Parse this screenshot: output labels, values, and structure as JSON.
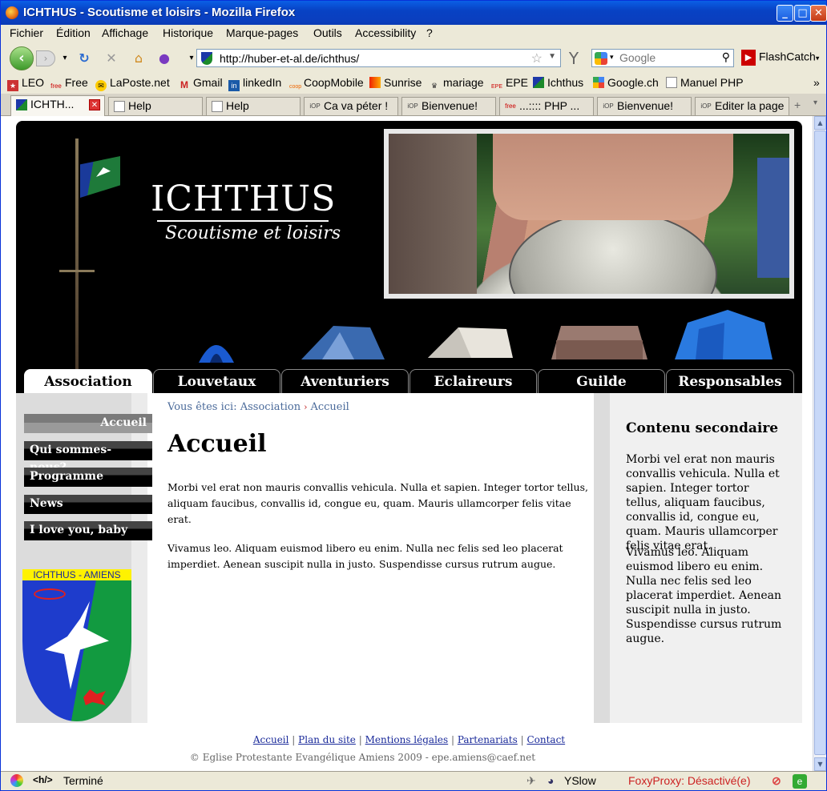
{
  "window": {
    "title": "ICHTHUS - Scoutisme et loisirs - Mozilla Firefox"
  },
  "menu": [
    "Fichier",
    "Édition",
    "Affichage",
    "Historique",
    "Marque-pages",
    "Outils",
    "Accessibility",
    "?"
  ],
  "toolbar": {
    "url": "http://huber-et-al.de/ichthus/",
    "search_placeholder": "Google",
    "flashcatch": "FlashCatch"
  },
  "bookmarks": [
    "LEO",
    "Free",
    "LaPoste.net",
    "Gmail",
    "linkedIn",
    "CoopMobile",
    "Sunrise",
    "mariage",
    "EPE",
    "Ichthus",
    "Google.ch",
    "Manuel PHP"
  ],
  "tabs": [
    "ICHTH...",
    "Help",
    "Help",
    "Ca va péter !",
    "Bienvenue!",
    "...:::: PHP ...",
    "Bienvenue!",
    "Editer la page"
  ],
  "site": {
    "logo_title": "ICHTHUS",
    "logo_subtitle": "Scoutisme et loisirs",
    "nav": [
      "Association",
      "Louvetaux",
      "Aventuriers",
      "Eclaireurs",
      "Guilde",
      "Responsables"
    ],
    "sidebar": [
      "Accueil",
      "Qui sommes-nous?",
      "Programme",
      "News",
      "I love you, baby"
    ],
    "crest_label": "ICHTHUS - AMIENS",
    "breadcrumb": {
      "prefix": "Vous êtes ici:",
      "section": "Association",
      "page": "Accueil"
    },
    "heading": "Accueil",
    "paragraphs": [
      "Morbi vel erat non mauris convallis vehicula. Nulla et sapien. Integer tortor tellus, aliquam faucibus, convallis id, congue eu, quam. Mauris ullamcorper felis vitae erat.",
      "Vivamus leo. Aliquam euismod libero eu enim. Nulla nec felis sed leo placerat imperdiet. Aenean suscipit nulla in justo. Suspendisse cursus rutrum augue."
    ],
    "secondary": {
      "title": "Contenu secondaire",
      "paragraphs": [
        "Morbi vel erat non mauris convallis vehicula. Nulla et sapien. Integer tortor tellus, aliquam faucibus, convallis id, congue eu, quam. Mauris ullamcorper felis vitae erat.",
        "Vivamus leo. Aliquam euismod libero eu enim. Nulla nec felis sed leo placerat imperdiet. Aenean suscipit nulla in justo. Suspendisse cursus rutrum augue."
      ]
    },
    "footer_links": [
      "Accueil",
      "Plan du site",
      "Mentions légales",
      "Partenariats",
      "Contact"
    ],
    "copyright": "© Eglise Protestante Evangélique Amiens 2009 - epe.amiens@caef.net"
  },
  "status": {
    "text": "Terminé",
    "yslow": "YSlow",
    "foxyproxy": "FoxyProxy: Désactivé(e)"
  }
}
